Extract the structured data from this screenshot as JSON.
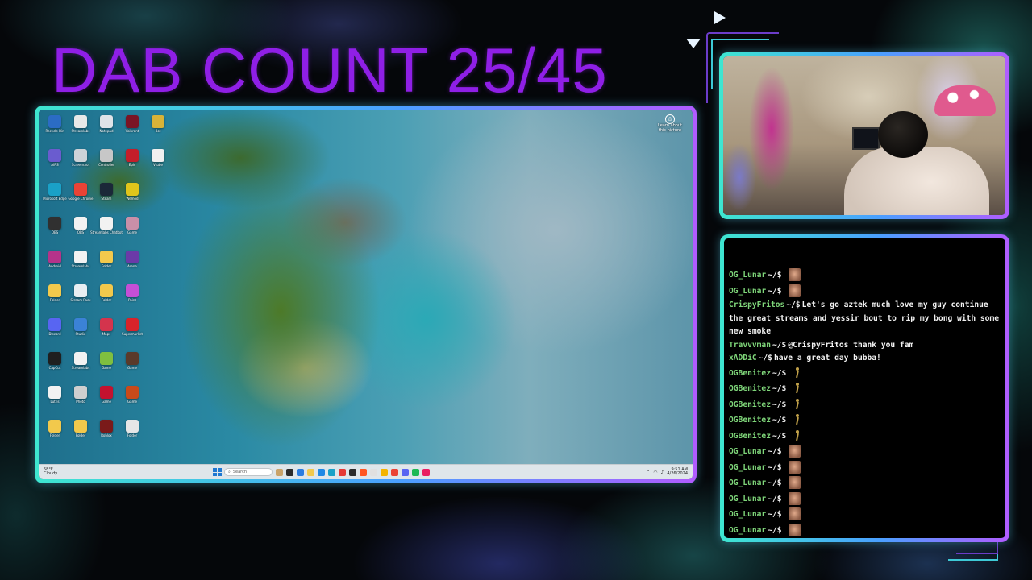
{
  "overlay": {
    "title": "DAB COUNT 25/45"
  },
  "desktop": {
    "icons": [
      {
        "label": "Recycle Bin",
        "color": "#2b6cc4"
      },
      {
        "label": "Streamlabs",
        "color": "#e8e8e8"
      },
      {
        "label": "Notepad",
        "color": "#dfe3e8"
      },
      {
        "label": "Valorant",
        "color": "#7a1424"
      },
      {
        "label": "Bot",
        "color": "#d9b338"
      },
      {
        "label": "AIRS",
        "color": "#6a5ccf"
      },
      {
        "label": "Screenshot",
        "color": "#cdd3d8"
      },
      {
        "label": "Controller",
        "color": "#c7c7c7"
      },
      {
        "label": "Epic",
        "color": "#c41e2a"
      },
      {
        "label": "Vtube",
        "color": "#f0f0f0"
      },
      {
        "label": "Microsoft Edge",
        "color": "#1aa1c7"
      },
      {
        "label": "Google Chrome",
        "color": "#ea4335"
      },
      {
        "label": "Steam",
        "color": "#1b2838"
      },
      {
        "label": "Wemod",
        "color": "#e0c51b"
      },
      {
        "label": "",
        "color": "transparent"
      },
      {
        "label": "OBS",
        "color": "#303030"
      },
      {
        "label": "OBS",
        "color": "#f2f2f2"
      },
      {
        "label": "Streamlabs Chatbot",
        "color": "#f2f2f2"
      },
      {
        "label": "Game",
        "color": "#c98fa8"
      },
      {
        "label": "",
        "color": "transparent"
      },
      {
        "label": "Android",
        "color": "#b5338a"
      },
      {
        "label": "Streamlabs",
        "color": "#f2f2f2"
      },
      {
        "label": "Folder",
        "color": "#f2c94c"
      },
      {
        "label": "Arena",
        "color": "#6b3aa8"
      },
      {
        "label": "",
        "color": "transparent"
      },
      {
        "label": "Folder",
        "color": "#f2c94c"
      },
      {
        "label": "Stream Pack",
        "color": "#e8eef2"
      },
      {
        "label": "Folder",
        "color": "#f2c94c"
      },
      {
        "label": "Paint",
        "color": "#c54fd6"
      },
      {
        "label": "",
        "color": "transparent"
      },
      {
        "label": "Discord",
        "color": "#5865f2"
      },
      {
        "label": "Studio",
        "color": "#3b82d6"
      },
      {
        "label": "Maps",
        "color": "#d4344d"
      },
      {
        "label": "Supermarket",
        "color": "#d8232a"
      },
      {
        "label": "",
        "color": "transparent"
      },
      {
        "label": "CapCut",
        "color": "#1f1f1f"
      },
      {
        "label": "Streamlabs",
        "color": "#f2f2f2"
      },
      {
        "label": "Game",
        "color": "#7fbf3f"
      },
      {
        "label": "Game",
        "color": "#5a3a2a"
      },
      {
        "label": "",
        "color": "transparent"
      },
      {
        "label": "Lutris",
        "color": "#f2f2f2"
      },
      {
        "label": "Photo",
        "color": "#cfcfcf"
      },
      {
        "label": "Game",
        "color": "#c4122f"
      },
      {
        "label": "Game",
        "color": "#c94a1a"
      },
      {
        "label": "",
        "color": "transparent"
      },
      {
        "label": "Folder",
        "color": "#f2c94c"
      },
      {
        "label": "Folder",
        "color": "#f2c94c"
      },
      {
        "label": "Roblox",
        "color": "#7a1a1a"
      },
      {
        "label": "Folder",
        "color": "#e6e6e6"
      },
      {
        "label": "",
        "color": "transparent"
      }
    ],
    "learn_about": "Learn about this picture",
    "taskbar": {
      "weather_temp": "58°F",
      "weather_desc": "Cloudy",
      "search_placeholder": "Search",
      "app_colors": [
        "#c9a36a",
        "#2b2b2b",
        "#2a7de1",
        "#f2c94c",
        "#1e88e5",
        "#1aa1c7",
        "#e53935",
        "#2b2b2b",
        "#ff5722",
        "#e0e0e0",
        "#f4b400",
        "#ea4335",
        "#5865f2",
        "#1db954",
        "#e91e63"
      ],
      "time": "9:51 AM",
      "date": "4/26/2024"
    }
  },
  "chat": {
    "messages": [
      {
        "user": "OG_Lunar",
        "prompt": "~/$",
        "text": "",
        "emote": "face"
      },
      {
        "user": "OG_Lunar",
        "prompt": "~/$",
        "text": "",
        "emote": "face"
      },
      {
        "user": "CrispyFritos",
        "prompt": "~/$",
        "text": "Let's go aztek much love my guy continue the great streams and yessir bout to rip my bong with some new smoke",
        "emote": ""
      },
      {
        "user": "Travvvman",
        "prompt": "~/$",
        "text": "@CrispyFritos thank you fam",
        "emote": ""
      },
      {
        "user": "xADDiC",
        "prompt": "~/$",
        "text": "have a great day bubba!",
        "emote": ""
      },
      {
        "user": "OGBenitez",
        "prompt": "~/$",
        "text": "",
        "emote": "dance"
      },
      {
        "user": "OGBenitez",
        "prompt": "~/$",
        "text": "",
        "emote": "dance"
      },
      {
        "user": "OGBenitez",
        "prompt": "~/$",
        "text": "",
        "emote": "dance"
      },
      {
        "user": "OGBenitez",
        "prompt": "~/$",
        "text": "",
        "emote": "dance"
      },
      {
        "user": "OGBenitez",
        "prompt": "~/$",
        "text": "",
        "emote": "dance"
      },
      {
        "user": "OG_Lunar",
        "prompt": "~/$",
        "text": "",
        "emote": "face"
      },
      {
        "user": "OG_Lunar",
        "prompt": "~/$",
        "text": "",
        "emote": "face"
      },
      {
        "user": "OG_Lunar",
        "prompt": "~/$",
        "text": "",
        "emote": "face"
      },
      {
        "user": "OG_Lunar",
        "prompt": "~/$",
        "text": "",
        "emote": "face"
      },
      {
        "user": "OG_Lunar",
        "prompt": "~/$",
        "text": "",
        "emote": "face"
      },
      {
        "user": "OG_Lunar",
        "prompt": "~/$",
        "text": "",
        "emote": "face"
      }
    ]
  },
  "colors": {
    "title": "#8f1fe6",
    "username": "#7fd67a",
    "frame_cyan": "#3ee6d0",
    "frame_purple": "#b15cff"
  }
}
